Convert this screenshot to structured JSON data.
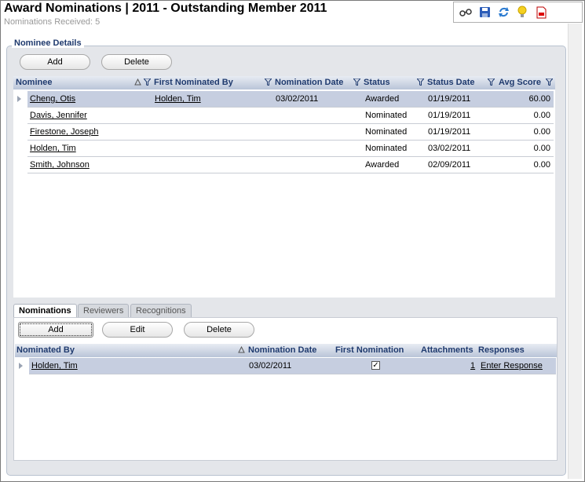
{
  "page": {
    "title": "Award Nominations | 2011 - Outstanding Member 2011",
    "subtitle": "Nominations Received: 5"
  },
  "toolbar": {
    "icons": [
      "glasses-icon",
      "save-icon",
      "refresh-icon",
      "lightbulb-icon",
      "pdf-icon"
    ]
  },
  "nominee_details": {
    "section_label": "Nominee Details",
    "add_label": "Add",
    "delete_label": "Delete",
    "columns": {
      "nominee": "Nominee",
      "first_nominated_by": "First Nominated By",
      "nomination_date": "Nomination Date",
      "status": "Status",
      "status_date": "Status Date",
      "avg_score": "Avg Score"
    },
    "rows": [
      {
        "nominee": "Cheng, Otis",
        "first_nominated_by": "Holden, Tim",
        "nomination_date": "03/02/2011",
        "status": "Awarded",
        "status_date": "01/19/2011",
        "avg_score": "60.00"
      },
      {
        "nominee": "Davis, Jennifer",
        "first_nominated_by": "",
        "nomination_date": "",
        "status": "Nominated",
        "status_date": "01/19/2011",
        "avg_score": "0.00"
      },
      {
        "nominee": "Firestone, Joseph",
        "first_nominated_by": "",
        "nomination_date": "",
        "status": "Nominated",
        "status_date": "01/19/2011",
        "avg_score": "0.00"
      },
      {
        "nominee": "Holden, Tim",
        "first_nominated_by": "",
        "nomination_date": "",
        "status": "Nominated",
        "status_date": "03/02/2011",
        "avg_score": "0.00"
      },
      {
        "nominee": "Smith, Johnson",
        "first_nominated_by": "",
        "nomination_date": "",
        "status": "Awarded",
        "status_date": "02/09/2011",
        "avg_score": "0.00"
      }
    ]
  },
  "tabs": [
    {
      "label": "Nominations",
      "active": true
    },
    {
      "label": "Reviewers",
      "active": false
    },
    {
      "label": "Recognitions",
      "active": false
    }
  ],
  "nominations": {
    "add_label": "Add",
    "edit_label": "Edit",
    "delete_label": "Delete",
    "columns": {
      "nominated_by": "Nominated By",
      "nomination_date": "Nomination Date",
      "first_nomination": "First Nomination",
      "attachments": "Attachments",
      "responses": "Responses"
    },
    "rows": [
      {
        "nominated_by": "Holden, Tim",
        "nomination_date": "03/02/2011",
        "first_nomination": true,
        "attachments": "1",
        "responses": "Enter Response"
      }
    ]
  },
  "colors": {
    "header_text": "#1f3a6e",
    "selected_row": "#c6cee0",
    "panel_bg": "#e4e6ea"
  }
}
